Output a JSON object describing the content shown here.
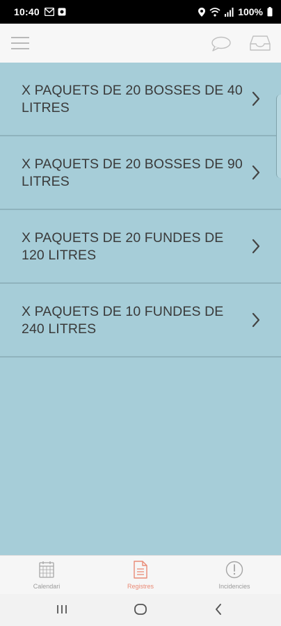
{
  "status_bar": {
    "time": "10:40",
    "battery_percent": "100%"
  },
  "header": {
    "menu_icon": "hamburger-menu-icon",
    "chat_icon": "chat-bubble-icon",
    "inbox_icon": "inbox-tray-icon"
  },
  "list": {
    "items": [
      {
        "label": "X PAQUETS DE 20 BOSSES DE 40 LITRES"
      },
      {
        "label": "X PAQUETS DE 20 BOSSES DE 90 LITRES"
      },
      {
        "label": "X PAQUETS DE 20 FUNDES DE 120 LITRES"
      },
      {
        "label": "X PAQUETS DE 10 FUNDES DE 240 LITRES"
      }
    ]
  },
  "tabs": [
    {
      "label": "Calendari",
      "icon": "calendar-icon",
      "active": false
    },
    {
      "label": "Registres",
      "icon": "document-icon",
      "active": true
    },
    {
      "label": "Incidencies",
      "icon": "alert-circle-icon",
      "active": false
    }
  ],
  "colors": {
    "background": "#a6cdd8",
    "accent": "#e98a75",
    "text": "#3a3a3a",
    "divider": "#8fb3bd"
  }
}
